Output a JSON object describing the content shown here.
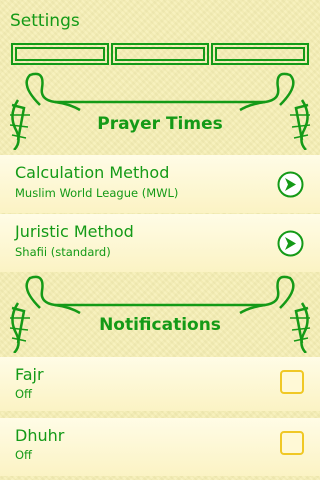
{
  "app": {
    "title": "Settings"
  },
  "sections": {
    "prayer_times": {
      "label": "Prayer Times"
    },
    "notifications": {
      "label": "Notifications"
    }
  },
  "prayer_settings": [
    {
      "title": "Calculation Method",
      "value": "Muslim World League (MWL)",
      "icon": "arrow-right-icon"
    },
    {
      "title": "Juristic Method",
      "value": "Shafii (standard)",
      "icon": "arrow-right-icon"
    }
  ],
  "notification_settings": [
    {
      "title": "Fajr",
      "value": "Off",
      "checked": false
    },
    {
      "title": "Dhuhr",
      "value": "Off",
      "checked": false
    }
  ],
  "colors": {
    "accent": "#149a17",
    "background": "#f6efb4",
    "checkbox_border": "#f0c825"
  }
}
